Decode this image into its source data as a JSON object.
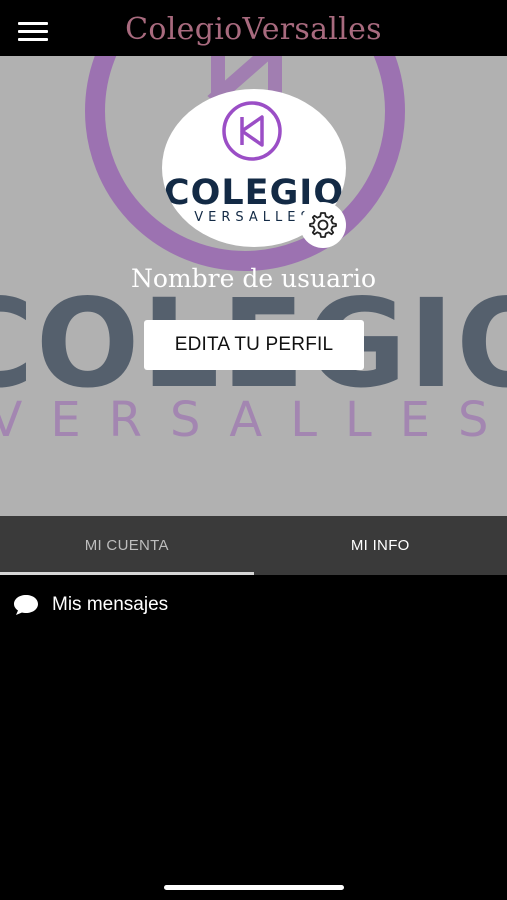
{
  "app": {
    "title": "ColegioVersalles",
    "title_color": "#a86a7e",
    "accent_color": "#9b4ec6",
    "navy_color": "#132a45"
  },
  "header": {
    "menu_icon": "hamburger-menu-icon"
  },
  "profile": {
    "logo_word": "COLEGIO",
    "logo_sub": "VERSALLES",
    "background_word": "COLEGIO",
    "background_sub": "VERSALLES",
    "username": "Nombre de usuario",
    "edit_button_label": "EDITA TU PERFIL",
    "settings_icon": "gear-icon"
  },
  "tabs": [
    {
      "label": "MI CUENTA",
      "selected": true,
      "color": "#bdbdbd"
    },
    {
      "label": "MI INFO",
      "selected": false,
      "color": "#ffffff"
    }
  ],
  "tab_indicator_color": "#d6d6d6",
  "menu_items": [
    {
      "label": "Mis mensajes",
      "icon": "chat-bubble-icon"
    }
  ]
}
